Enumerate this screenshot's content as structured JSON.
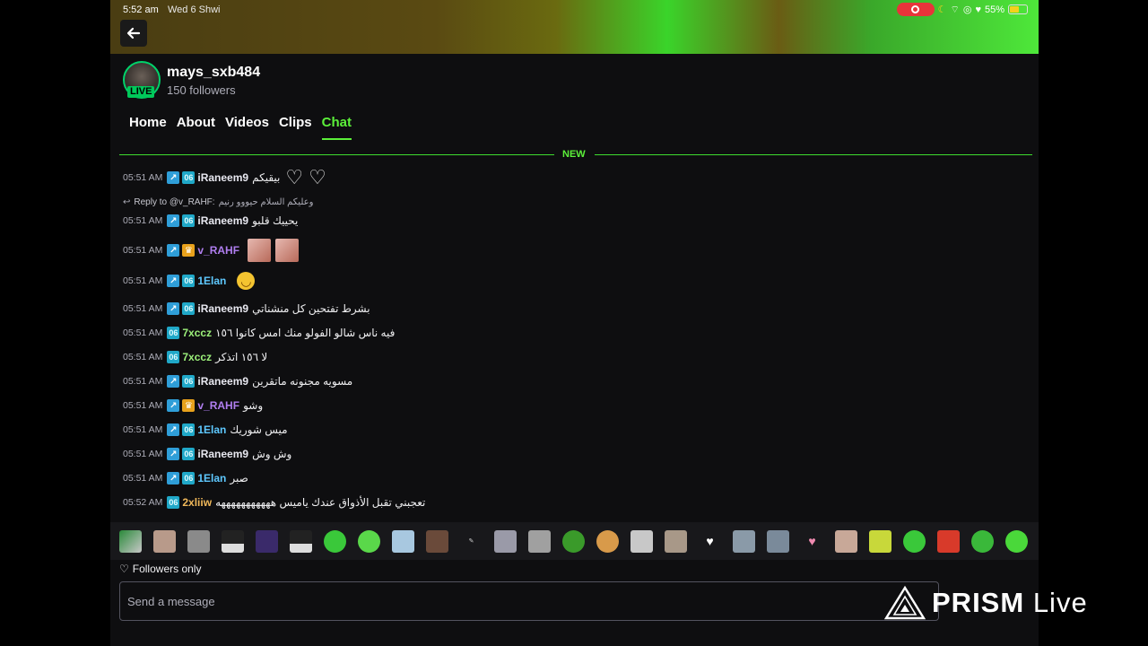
{
  "status": {
    "time": "5:52 am",
    "date": "Wed 6 Shwi",
    "battery": "55%",
    "battery_level": 0.55
  },
  "channel": {
    "name": "mays_sxb484",
    "followers": "150 followers",
    "live_label": "LIVE"
  },
  "tabs": [
    {
      "label": "Home"
    },
    {
      "label": "About"
    },
    {
      "label": "Videos"
    },
    {
      "label": "Clips"
    },
    {
      "label": "Chat",
      "active": true
    }
  ],
  "chat": {
    "new_label": "NEW",
    "reply": {
      "prefix": "Reply to @v_RAHF:",
      "text": "وعليكم السلام حيووو رنيم"
    },
    "messages": [
      {
        "time": "05:51 AM",
        "user": "iRaneem9",
        "text": "بيقيكم",
        "color": "#e8e8f0"
      },
      {
        "time": "05:51 AM",
        "user": "iRaneem9",
        "text": "يحييك قلبو",
        "color": "#e8e8f0"
      },
      {
        "time": "05:51 AM",
        "user": "v_RAHF",
        "text": "",
        "color": "#b07ef0"
      },
      {
        "time": "05:51 AM",
        "user": "1Elan",
        "text": "",
        "color": "#5ec8ff"
      },
      {
        "time": "05:51 AM",
        "user": "iRaneem9",
        "text": "بشرط تفتحين كل منشناتي",
        "color": "#e8e8f0"
      },
      {
        "time": "05:51 AM",
        "user": "7xccz",
        "text": "فيه ناس شالو الفولو منك امس كانوا ١٥٦",
        "color": "#9cf07a"
      },
      {
        "time": "05:51 AM",
        "user": "7xccz",
        "text": "لا ١٥٦ اتذكر",
        "color": "#9cf07a"
      },
      {
        "time": "05:51 AM",
        "user": "iRaneem9",
        "text": "مسويه مجنونه ماتقرين",
        "color": "#e8e8f0"
      },
      {
        "time": "05:51 AM",
        "user": "v_RAHF",
        "text": "وشو",
        "color": "#b07ef0"
      },
      {
        "time": "05:51 AM",
        "user": "1Elan",
        "text": "ميس شوريك",
        "color": "#5ec8ff"
      },
      {
        "time": "05:51 AM",
        "user": "iRaneem9",
        "text": "وش وش",
        "color": "#e8e8f0"
      },
      {
        "time": "05:51 AM",
        "user": "1Elan",
        "text": "صبر",
        "color": "#5ec8ff"
      },
      {
        "time": "05:52 AM",
        "user": "2xliiw",
        "text": "تعجبني تقبل الأذواق عندك ياميس هههههههههههه",
        "color": "#f0b85a"
      }
    ]
  },
  "composer": {
    "followers_only": "Followers only",
    "placeholder": "Send a message"
  },
  "watermark": {
    "brand": "PRISM",
    "suffix": "Live"
  },
  "colors": {
    "accent": "#5cf03a",
    "background": "#0e0e10",
    "live": "#00c85a"
  }
}
